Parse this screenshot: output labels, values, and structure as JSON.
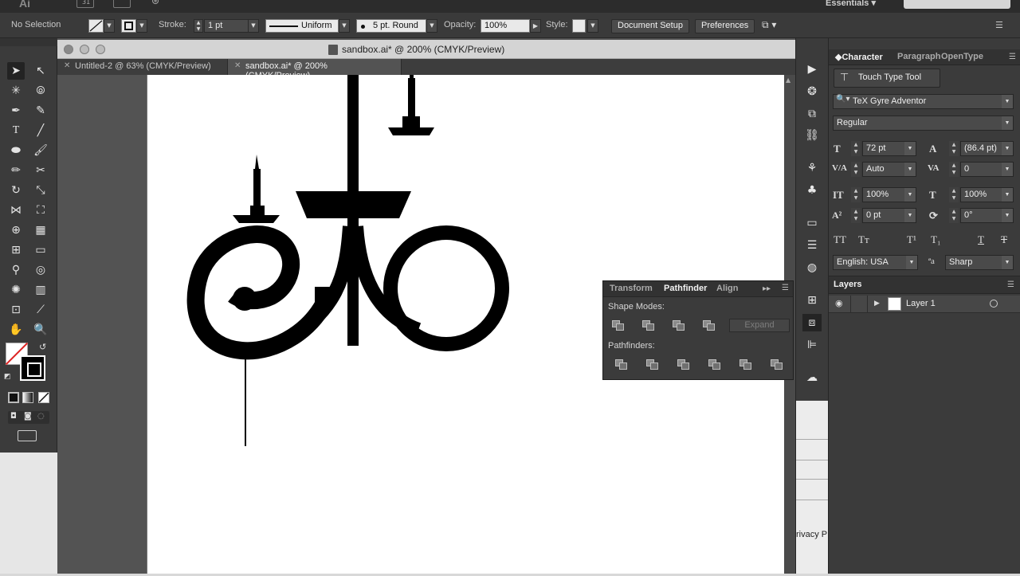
{
  "appbar": {
    "app_logo": "Ai",
    "workspace": "Essentials",
    "doc_icon_text": "31"
  },
  "control": {
    "selection": "No Selection",
    "stroke_label": "Stroke:",
    "stroke_value": "1 pt",
    "profile": "Uniform",
    "brush": "5 pt. Round",
    "opacity_label": "Opacity:",
    "opacity_value": "100%",
    "style_label": "Style:",
    "doc_setup": "Document Setup",
    "preferences": "Preferences"
  },
  "document": {
    "title": "sandbox.ai* @ 200% (CMYK/Preview)",
    "tabs": [
      {
        "label": "Untitled-2 @ 63% (CMYK/Preview)",
        "active": false
      },
      {
        "label": "sandbox.ai* @ 200% (CMYK/Preview)",
        "active": true
      }
    ]
  },
  "pathfinder": {
    "tabs": [
      "Transform",
      "Pathfinder",
      "Align"
    ],
    "active_tab": "Pathfinder",
    "shape_modes_label": "Shape Modes:",
    "pathfinders_label": "Pathfinders:",
    "expand_label": "Expand"
  },
  "character": {
    "tabs": [
      "Character",
      "Paragraph",
      "OpenType"
    ],
    "active_tab": "Character",
    "touch_type": "Touch Type Tool",
    "font_family": "TeX Gyre Adventor",
    "font_style": "Regular",
    "font_size": "72 pt",
    "leading": "(86.4 pt)",
    "kerning": "Auto",
    "tracking": "0",
    "vscale": "100%",
    "hscale": "100%",
    "baseline": "0 pt",
    "rotation": "0°",
    "language": "English: USA",
    "antialias": "Sharp"
  },
  "layers": {
    "title": "Layers",
    "items": [
      {
        "name": "Layer 1"
      }
    ]
  },
  "dock": {
    "web_text": "rivacy P"
  },
  "colors": {
    "ui_dark": "#3b3b3b",
    "artboard": "#ffffff",
    "art": "#000000"
  }
}
